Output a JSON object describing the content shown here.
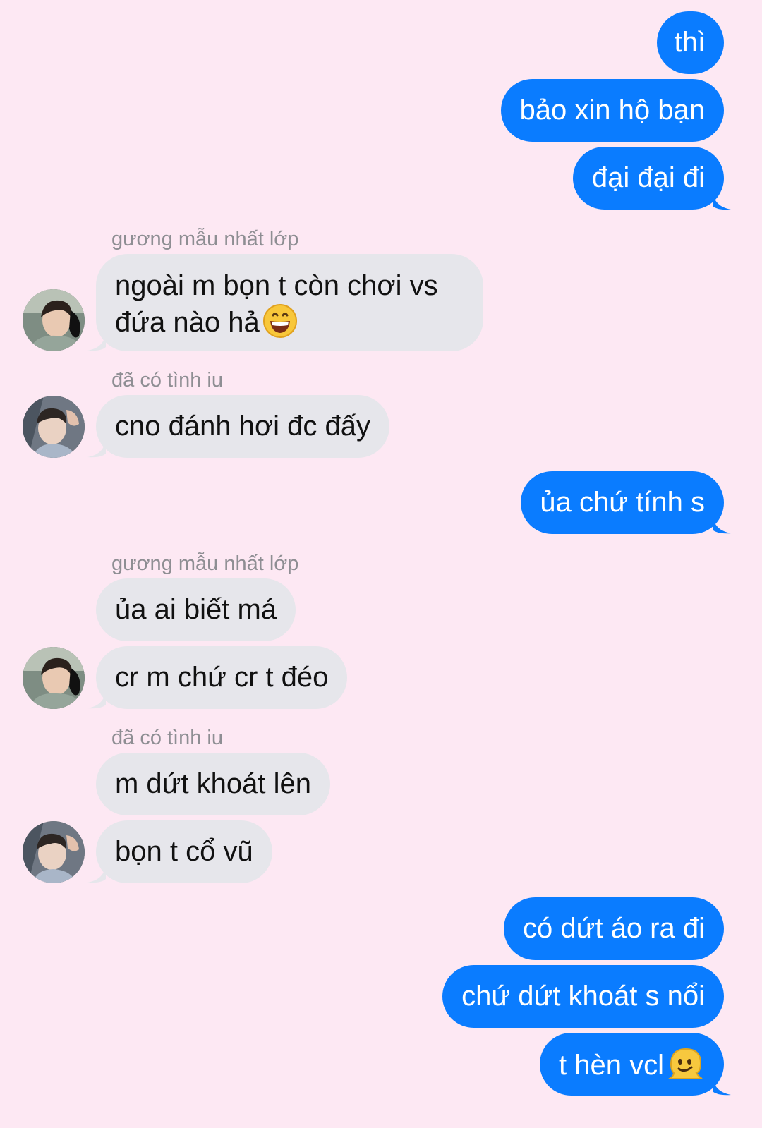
{
  "messages": [
    {
      "id": "m1",
      "from": "me",
      "text": "thì"
    },
    {
      "id": "m2",
      "from": "me",
      "text": "bảo xin hộ bạn"
    },
    {
      "id": "m3",
      "from": "me",
      "text": "đại đại đi"
    },
    {
      "id": "m4",
      "from": "guong",
      "sender": "gương mẫu nhất lớp",
      "text_line1": "ngoài m bọn t còn chơi vs",
      "text_line2": "đứa nào hả",
      "emoji": "grinning-face-emoji"
    },
    {
      "id": "m5",
      "from": "tinhiu",
      "sender": "đã có tình iu",
      "text": "cno đánh hơi đc đấy"
    },
    {
      "id": "m6",
      "from": "me",
      "text": "ủa chứ tính s"
    },
    {
      "id": "m7",
      "from": "guong",
      "sender": "gương mẫu nhất lớp",
      "text": "ủa ai biết má"
    },
    {
      "id": "m8",
      "from": "guong",
      "text": "cr m chứ cr t đéo"
    },
    {
      "id": "m9",
      "from": "tinhiu",
      "sender": "đã có tình iu",
      "text": "m dứt khoát lên"
    },
    {
      "id": "m10",
      "from": "tinhiu",
      "text": "bọn t cổ vũ"
    },
    {
      "id": "m11",
      "from": "me",
      "text": "có dứt áo ra đi"
    },
    {
      "id": "m12",
      "from": "me",
      "text": "chứ dứt khoát s nổi"
    },
    {
      "id": "m13",
      "from": "me",
      "text": "t hèn vcl",
      "emoji": "melting-face-emoji"
    }
  ],
  "colors": {
    "background": "#fde8f3",
    "outgoing_bubble": "#0a7cff",
    "incoming_bubble": "#e6e6eb",
    "sender_name": "#8e8e93"
  }
}
